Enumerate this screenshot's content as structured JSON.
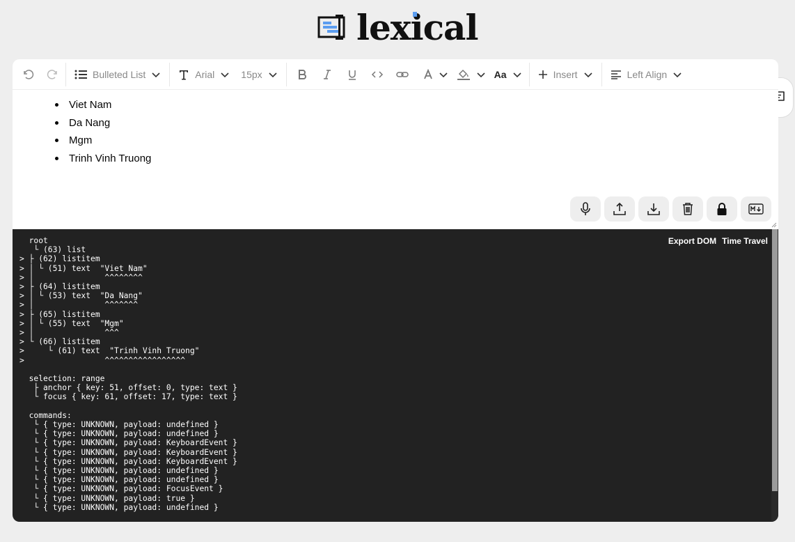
{
  "brand": {
    "name": "lexical"
  },
  "toolbar": {
    "block_type": "Bulleted List",
    "font_family": "Arial",
    "font_size": "15px",
    "font_case_label": "Aa",
    "insert_label": "Insert",
    "align_label": "Left Align"
  },
  "content": {
    "items": [
      "Viet Nam",
      "Da Nang",
      "Mgm",
      "Trinh Vinh Truong"
    ]
  },
  "tree_view": {
    "export_dom_label": "Export DOM",
    "time_travel_label": "Time Travel",
    "lines": [
      "  root",
      "   └ (63) list",
      "> ├ (62) listitem",
      "> │ └ (51) text  \"Viet Nam\"",
      "> │               ^^^^^^^^",
      "> ├ (64) listitem",
      "> │ └ (53) text  \"Da Nang\"",
      "> │               ^^^^^^^",
      "> ├ (65) listitem",
      "> │ └ (55) text  \"Mgm\"",
      "> │               ^^^",
      "> └ (66) listitem",
      ">     └ (61) text  \"Trinh Vinh Truong\"",
      ">                 ^^^^^^^^^^^^^^^^^",
      "",
      "  selection: range",
      "   ├ anchor { key: 51, offset: 0, type: text }",
      "   └ focus { key: 61, offset: 17, type: text }",
      "",
      "  commands:",
      "   └ { type: UNKNOWN, payload: undefined }",
      "   └ { type: UNKNOWN, payload: undefined }",
      "   └ { type: UNKNOWN, payload: KeyboardEvent }",
      "   └ { type: UNKNOWN, payload: KeyboardEvent }",
      "   └ { type: UNKNOWN, payload: KeyboardEvent }",
      "   └ { type: UNKNOWN, payload: undefined }",
      "   └ { type: UNKNOWN, payload: undefined }",
      "   └ { type: UNKNOWN, payload: FocusEvent }",
      "   └ { type: UNKNOWN, payload: true }",
      "   └ { type: UNKNOWN, payload: undefined }"
    ]
  },
  "colors": {
    "tree_bg": "#222222",
    "accent": "#5b9df0",
    "page_bg": "#eeeeee"
  }
}
